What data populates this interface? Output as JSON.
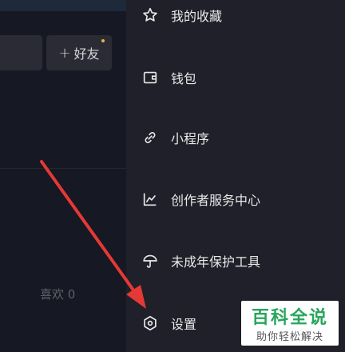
{
  "profile": {
    "add_friend_label": "好友",
    "likes_label": "喜欢 0"
  },
  "drawer": {
    "items": [
      {
        "label": "我的收藏",
        "icon": "star-icon"
      },
      {
        "label": "钱包",
        "icon": "wallet-icon"
      },
      {
        "label": "小程序",
        "icon": "link-icon"
      },
      {
        "label": "创作者服务中心",
        "icon": "chart-icon"
      },
      {
        "label": "未成年保护工具",
        "icon": "umbrella-icon"
      },
      {
        "label": "设置",
        "icon": "settings-icon"
      }
    ]
  },
  "watermark": {
    "title": "百科全说",
    "subtitle": "助你轻松解决"
  },
  "colors": {
    "background": "#161823",
    "drawer": "#1f2029",
    "arrow": "#e53935",
    "watermark_green": "#26a65b"
  }
}
